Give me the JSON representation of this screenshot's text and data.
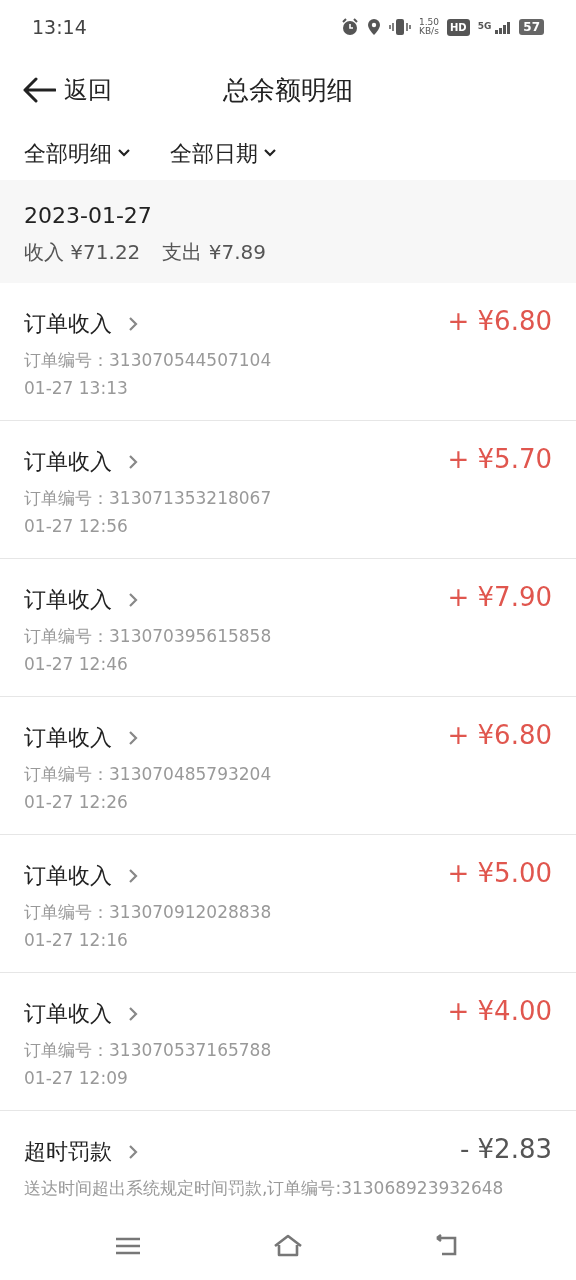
{
  "status_bar": {
    "time": "13:14",
    "speed_value": "1.50",
    "speed_unit": "KB/s",
    "hd": "HD",
    "network": "5G",
    "battery": "57"
  },
  "header": {
    "back": "返回",
    "title": "总余额明细"
  },
  "filters": [
    {
      "label": "全部明细"
    },
    {
      "label": "全部日期"
    }
  ],
  "summary": {
    "date": "2023-01-27",
    "income": "收入 ¥71.22",
    "expense": "支出 ¥7.89"
  },
  "items": [
    {
      "kind": "income",
      "title": "订单收入",
      "amount": "+ ¥6.80",
      "detail": "订单编号：313070544507104",
      "time": "01-27 13:13"
    },
    {
      "kind": "income",
      "title": "订单收入",
      "amount": "+ ¥5.70",
      "detail": "订单编号：313071353218067",
      "time": "01-27 12:56"
    },
    {
      "kind": "income",
      "title": "订单收入",
      "amount": "+ ¥7.90",
      "detail": "订单编号：313070395615858",
      "time": "01-27 12:46"
    },
    {
      "kind": "income",
      "title": "订单收入",
      "amount": "+ ¥6.80",
      "detail": "订单编号：313070485793204",
      "time": "01-27 12:26"
    },
    {
      "kind": "income",
      "title": "订单收入",
      "amount": "+ ¥5.00",
      "detail": "订单编号：313070912028838",
      "time": "01-27 12:16"
    },
    {
      "kind": "income",
      "title": "订单收入",
      "amount": "+ ¥4.00",
      "detail": "订单编号：313070537165788",
      "time": "01-27 12:09"
    },
    {
      "kind": "penalty",
      "title": "超时罚款",
      "amount": "- ¥2.83",
      "detail": "送达时间超出系统规定时间罚款,订单编号:313068923932648"
    }
  ]
}
